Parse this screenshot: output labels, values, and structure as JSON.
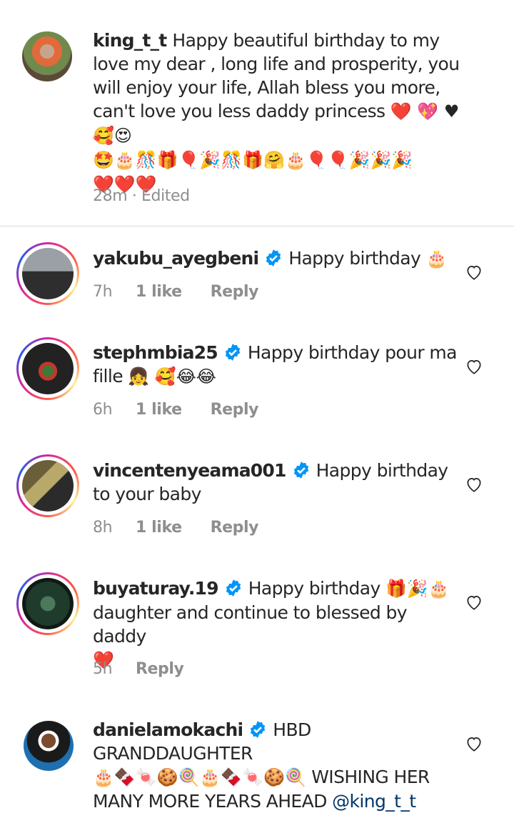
{
  "caption": {
    "username": "king_t_t",
    "text": "Happy beautiful birthday to my love my dear , long life and prosperity, you will enjoy your life, Allah bless you more, can't love you  less daddy princess",
    "emoji_line1": "❤️ 💖 ♥ 🥰😍",
    "emoji_line2": "🤩🎂🎊🎁🎈🎉🎊🎁🤗🎂🎈🎈🎉🎉🎉",
    "emoji_line3": "❤️❤️❤️",
    "time": "28m · Edited"
  },
  "comments": [
    {
      "username": "yakubu_ayegbeni",
      "text": "Happy birthday",
      "emoji": "🎂",
      "time": "7h",
      "likes": "1 like",
      "reply": "Reply"
    },
    {
      "username": "stephmbia25",
      "text": "Happy birthday pour ma fille",
      "emoji": "👧 🥰😂😂",
      "time": "6h",
      "likes": "1 like",
      "reply": "Reply"
    },
    {
      "username": "vincentenyeama001",
      "text": "Happy birthday to your baby",
      "time": "8h",
      "likes": "1 like",
      "reply": "Reply"
    },
    {
      "username": "buyaturay.19",
      "text_a": "Happy birthday",
      "emoji_a": "🎁🎉🎂",
      "text_b": "daughter and continue to blessed by daddy",
      "emoji_b": "❤️",
      "time": "5h",
      "reply": "Reply"
    },
    {
      "username": "danielamokachi",
      "text_a": "HBD GRANDDAUGHTER",
      "emoji_a": "🎂🍫🍬🍪🍭🎂🍫🍬🍪🍭",
      "text_b": "WISHING HER MANY MORE YEARS AHEAD",
      "mention": "@king_t_t"
    }
  ],
  "colors": {
    "text": "#262626",
    "meta": "#8e8e8e",
    "verified": "#0095f6",
    "mention": "#00376b",
    "divider": "#dbdbdb"
  }
}
